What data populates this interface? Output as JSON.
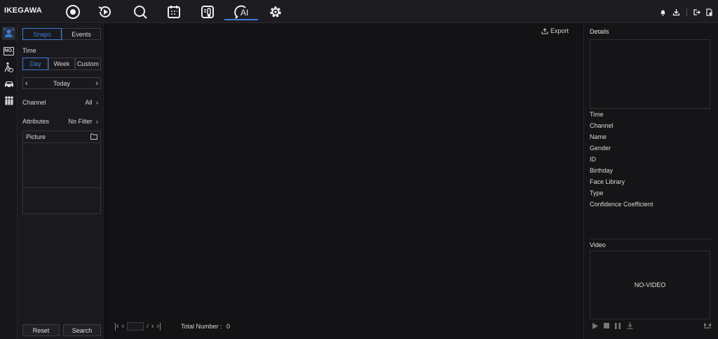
{
  "brand": "IKEGAWA",
  "nav": {
    "icons": [
      "live-view-icon",
      "playback-icon",
      "search-icon",
      "schedule-icon",
      "thermal-icon",
      "ai-icon",
      "settings-icon"
    ],
    "active": "ai-icon",
    "ai_label": "AI"
  },
  "top_right": [
    "bell-icon",
    "download-icon",
    "logout-icon",
    "account-icon"
  ],
  "side_icons": [
    "face-icon",
    "license-plate-icon",
    "pedestrian-icon",
    "vehicle-icon",
    "crowd-icon"
  ],
  "side_plate_label": "NO.",
  "filter": {
    "tabs": [
      "Snaps",
      "Events"
    ],
    "selected_tab": "Snaps",
    "time_label": "Time",
    "ranges": [
      "Day",
      "Week",
      "Custom"
    ],
    "selected_range": "Day",
    "day_value": "Today",
    "channel_label": "Channel",
    "channel_value": "All",
    "attributes_label": "Attributes",
    "attributes_value": "No Filter",
    "picture_label": "Picture",
    "reset_label": "Reset",
    "search_label": "Search"
  },
  "main": {
    "export_label": "Export",
    "page_separator": "/",
    "total_label": "Total Number :",
    "total_value": "0"
  },
  "details": {
    "title": "Details",
    "fields": [
      "Time",
      "Channel",
      "Name",
      "Gender",
      "ID",
      "Birthday",
      "Face Library",
      "Type",
      "Confidence Coefficient"
    ]
  },
  "video": {
    "title": "Video",
    "placeholder": "NO-VIDEO"
  },
  "colors": {
    "accent": "#3e7bd6",
    "background": "#121214"
  }
}
